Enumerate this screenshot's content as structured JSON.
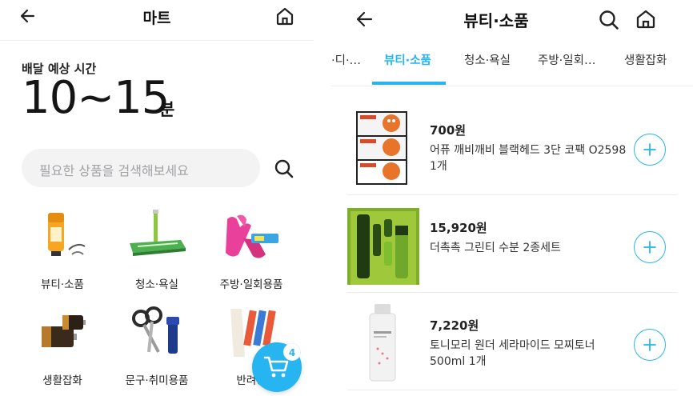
{
  "left": {
    "header": {
      "title": "마트",
      "back_icon": "back-arrow-icon",
      "home_icon": "home-icon"
    },
    "delivery": {
      "label": "배달 예상 시간",
      "time": "10~15",
      "unit": "분"
    },
    "search": {
      "placeholder": "필요한 상품을 검색해보세요",
      "icon": "search-icon"
    },
    "categories": [
      {
        "label": "뷰티·소품",
        "icon": "sunscreen-icon"
      },
      {
        "label": "청소·욕실",
        "icon": "mop-icon"
      },
      {
        "label": "주방·일회용품",
        "icon": "rubber-gloves-icon"
      },
      {
        "label": "생활잡화",
        "icon": "battery-icon"
      },
      {
        "label": "문구·취미용품",
        "icon": "scissors-icon"
      },
      {
        "label": "반려용",
        "icon": "pet-treats-icon"
      }
    ],
    "cart": {
      "icon": "cart-icon",
      "count": "4",
      "color": "#26b5f0"
    }
  },
  "right": {
    "header": {
      "title": "뷰티·소품",
      "back_icon": "back-arrow-icon",
      "search_icon": "search-icon",
      "home_icon": "home-icon"
    },
    "tabs": [
      {
        "label": "·디·…",
        "active": false
      },
      {
        "label": "뷰티·소품",
        "active": true
      },
      {
        "label": "청소·욕실",
        "active": false
      },
      {
        "label": "주방·일회…",
        "active": false
      },
      {
        "label": "생활잡화",
        "active": false
      }
    ],
    "accent_color": "#26b5f0",
    "products": [
      {
        "price": "700원",
        "name": "어퓨 깨비깨비 블랙헤드 3단 코팩 O2598 1개",
        "image": "nose-pack-image"
      },
      {
        "price": "15,920원",
        "name": "더촉촉 그린티 수분 2종세트",
        "image": "green-tea-set-image"
      },
      {
        "price": "7,220원",
        "name": "토니모리 원더 세라마이드 모찌토너 500ml 1개",
        "image": "toner-bottle-image"
      }
    ]
  }
}
